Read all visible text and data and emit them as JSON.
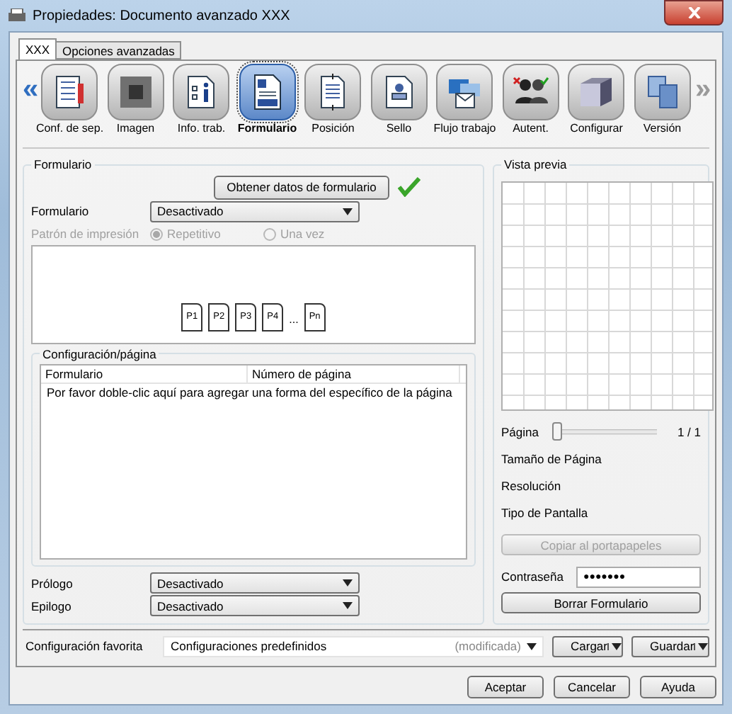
{
  "window": {
    "title": "Propiedades: Documento avanzado XXX"
  },
  "tabs": [
    {
      "label": "XXX",
      "selected": true
    },
    {
      "label": "Opciones avanzadas",
      "selected": false
    }
  ],
  "toolbar": {
    "scroll": [
      {
        "glyph": "«",
        "disabled": false
      },
      {
        "glyph": "»",
        "disabled": true
      }
    ],
    "items": [
      {
        "kind": "list",
        "label": "Conf. de sep.",
        "selected": false
      },
      {
        "kind": "square",
        "label": "Imagen",
        "selected": false
      },
      {
        "kind": "info",
        "label": "Info. trab.",
        "selected": false
      },
      {
        "kind": "form",
        "label": "Formulario",
        "selected": true
      },
      {
        "kind": "position",
        "label": "Posición",
        "selected": false
      },
      {
        "kind": "stamp",
        "label": "Sello",
        "selected": false
      },
      {
        "kind": "workflow",
        "label": "Flujo trabajo",
        "selected": false
      },
      {
        "kind": "users",
        "label": "Autent.",
        "selected": false
      },
      {
        "kind": "device",
        "label": "Configurar",
        "selected": false
      },
      {
        "kind": "layers",
        "label": "Versión",
        "selected": false
      }
    ]
  },
  "form_group": {
    "title": "Formulario",
    "fetch_button": "Obtener datos de formulario",
    "fetch_ok": true,
    "field": {
      "label": "Formulario",
      "value": "Desactivado"
    },
    "pattern": {
      "label": "Patrón de impresión",
      "disabled": true,
      "options": [
        {
          "label": "Repetitivo",
          "selected": true
        },
        {
          "label": "Una vez",
          "selected": false
        }
      ]
    },
    "pages": [
      {
        "kind": "page",
        "label": "P1"
      },
      {
        "kind": "page",
        "label": "P2"
      },
      {
        "kind": "page",
        "label": "P3"
      },
      {
        "kind": "page",
        "label": "P4"
      },
      {
        "kind": "gap",
        "label": "..."
      },
      {
        "kind": "page",
        "label": "Pn"
      }
    ],
    "per_page": {
      "title": "Configuración/página",
      "columns": [
        "Formulario",
        "Número de página"
      ],
      "hint": "Por favor doble-clic aquí para agregar una forma del específico de la página"
    },
    "extra_fields": [
      {
        "label": "Prólogo",
        "value": "Desactivado"
      },
      {
        "label": "Epilogo",
        "value": "Desactivado"
      }
    ]
  },
  "preview": {
    "title": "Vista previa",
    "page_label": "Página",
    "level": 0,
    "reading": "1 / 1",
    "info": [
      "Tamaño de Página",
      "Resolución",
      "Tipo de Pantalla"
    ],
    "copy_button": {
      "label": "Copiar al portapapeles",
      "disabled": true
    },
    "password": {
      "label": "Contraseña",
      "value": "●●●●●●●"
    },
    "clear_button": "Borrar Formulario"
  },
  "favorites": {
    "label": "Configuración favorita",
    "value": "Configuraciones predefinidos",
    "note": "(modificada)",
    "buttons": [
      "Cargar",
      "Guardar"
    ]
  },
  "buttons": [
    "Aceptar",
    "Cancelar",
    "Ayuda"
  ]
}
